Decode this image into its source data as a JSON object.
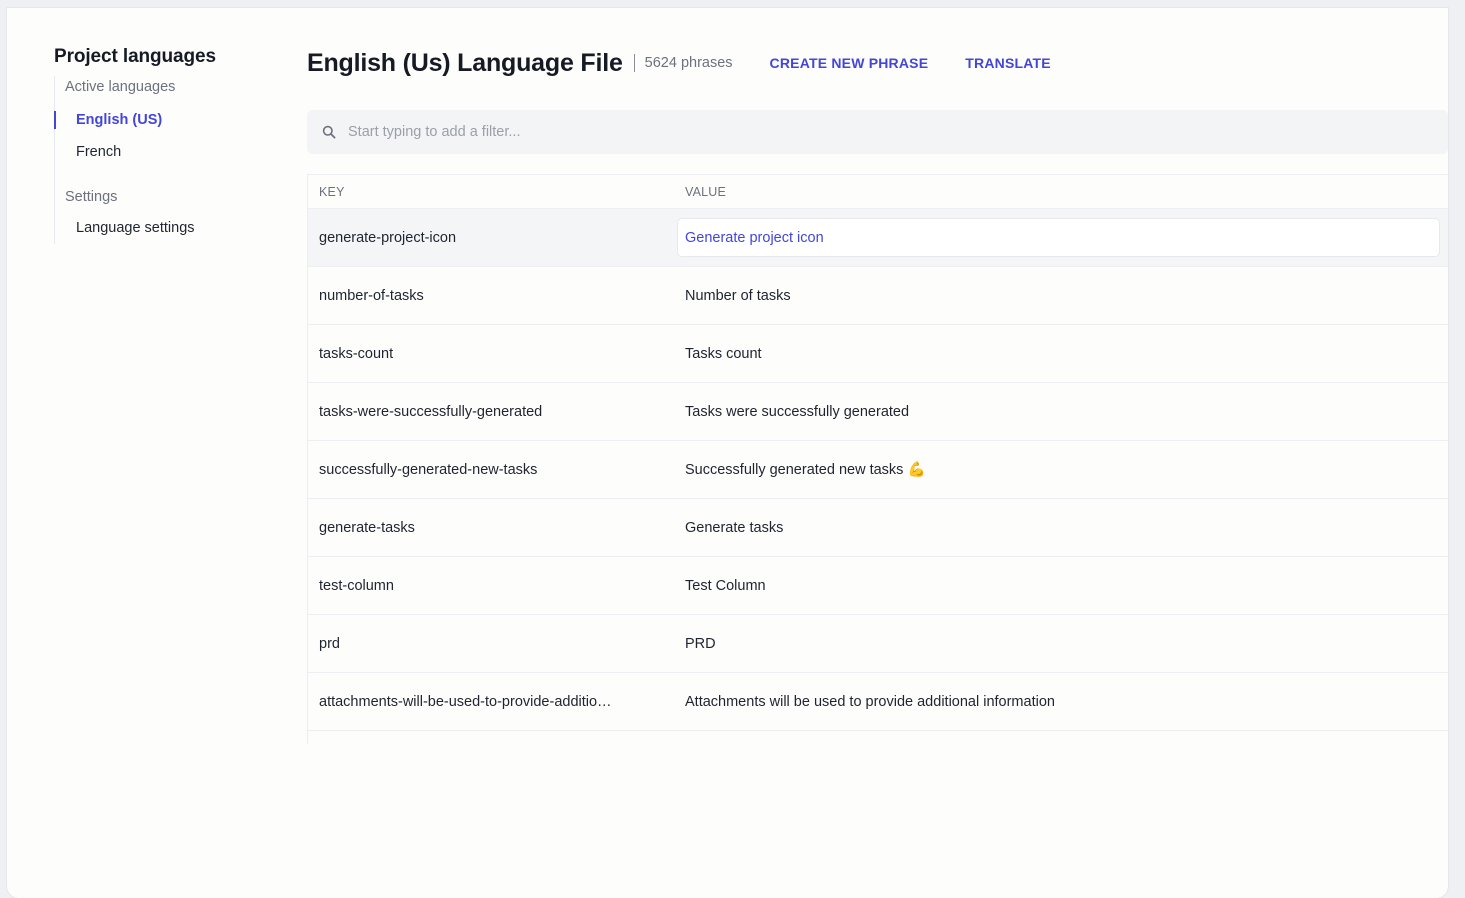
{
  "sidebar": {
    "title": "Project languages",
    "active_languages_label": "Active languages",
    "languages": [
      {
        "label": "English (US)",
        "active": true
      },
      {
        "label": "French",
        "active": false
      }
    ],
    "settings_label": "Settings",
    "settings_items": [
      {
        "label": "Language settings"
      }
    ]
  },
  "header": {
    "title": "English (Us) Language File",
    "phrase_count": "5624 phrases",
    "create_label": "CREATE NEW PHRASE",
    "translate_label": "TRANSLATE"
  },
  "search": {
    "placeholder": "Start typing to add a filter...",
    "value": ""
  },
  "table": {
    "headers": {
      "key": "KEY",
      "value": "VALUE"
    },
    "rows": [
      {
        "key": "generate-project-icon",
        "value": "Generate project icon",
        "editing": true
      },
      {
        "key": "number-of-tasks",
        "value": "Number of tasks"
      },
      {
        "key": "tasks-count",
        "value": "Tasks count"
      },
      {
        "key": "tasks-were-successfully-generated",
        "value": "Tasks were successfully generated"
      },
      {
        "key": "successfully-generated-new-tasks",
        "value": "Successfully generated new tasks 💪"
      },
      {
        "key": "generate-tasks",
        "value": "Generate tasks"
      },
      {
        "key": "test-column",
        "value": "Test Column"
      },
      {
        "key": "prd",
        "value": "PRD"
      },
      {
        "key": "attachments-will-be-used-to-provide-additio…",
        "value": "Attachments will be used to provide additional information"
      }
    ]
  },
  "colors": {
    "accent": "#4346d8",
    "text": "#1f2430",
    "muted": "#6c717d"
  }
}
